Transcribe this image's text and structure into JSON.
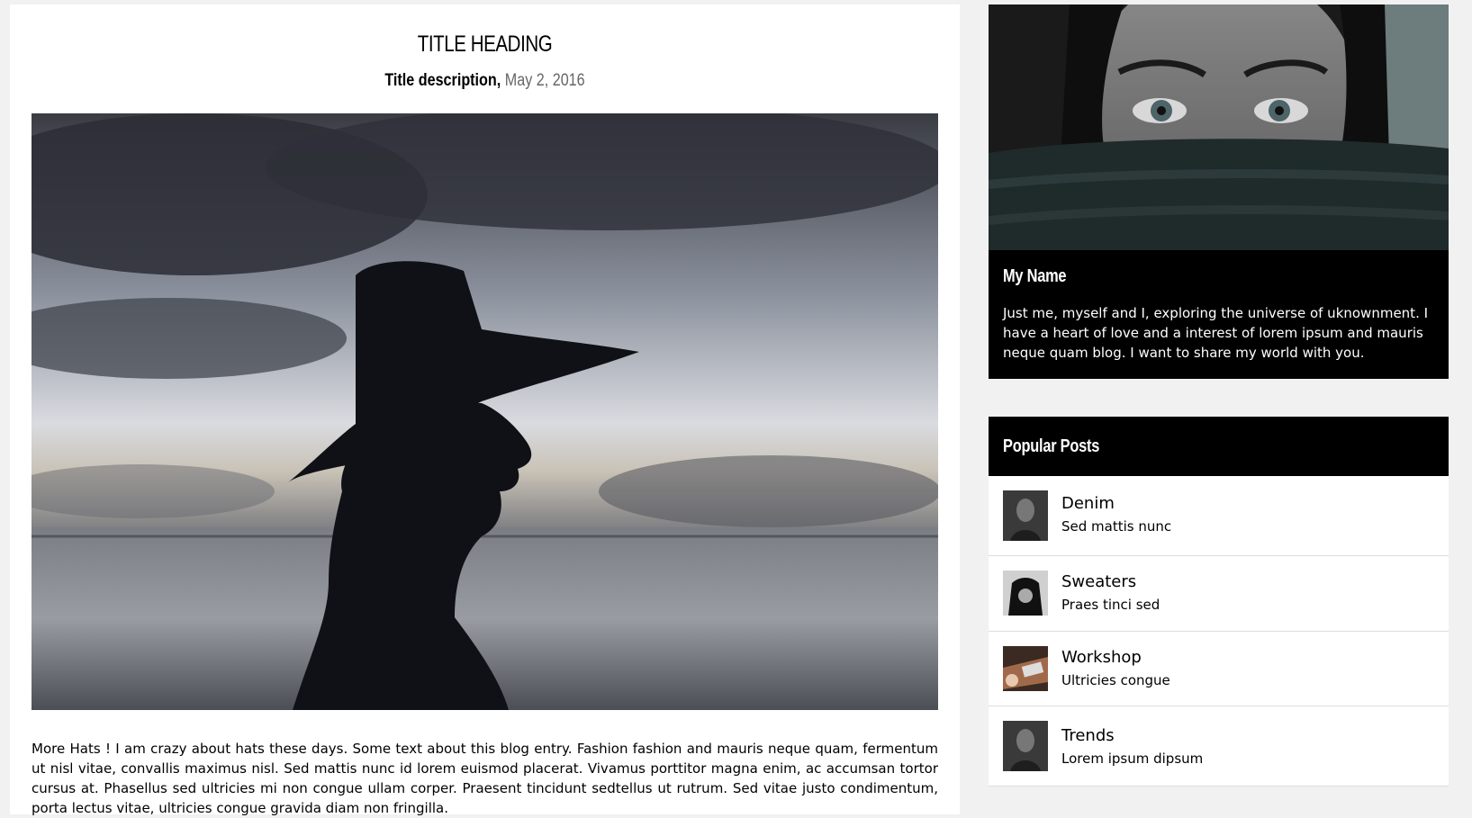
{
  "post": {
    "title": "TITLE HEADING",
    "description": "Title description,",
    "date": "May 2, 2016",
    "body": "More Hats !  I am crazy about hats these days. Some text about this blog entry. Fashion fashion and mauris neque quam, fermentum ut nisl vitae, convallis maximus nisl. Sed mattis nunc id lorem euismod placerat. Vivamus porttitor magna enim, ac accumsan tortor cursus at. Phasellus sed ultricies mi non congue ullam corper. Praesent tincidunt sedtellus ut rutrum. Sed vitae justo condimentum, porta lectus vitae, ultricies congue gravida diam non fringilla."
  },
  "profile": {
    "name": "My Name",
    "bio": "Just me, myself and I, exploring the universe of uknownment. I have a heart of love and a interest of lorem ipsum and mauris neque quam blog. I want to share my world with you."
  },
  "popular": {
    "title": "Popular Posts",
    "items": [
      {
        "title": "Denim",
        "subtitle": "Sed mattis nunc"
      },
      {
        "title": "Sweaters",
        "subtitle": "Praes tinci sed"
      },
      {
        "title": "Workshop",
        "subtitle": "Ultricies congue"
      },
      {
        "title": "Trends",
        "subtitle": "Lorem ipsum dipsum"
      }
    ]
  },
  "colors": {
    "page_bg": "#f1f1f1",
    "card_bg": "#ffffff",
    "dark": "#000000",
    "date_gray": "#666666"
  }
}
